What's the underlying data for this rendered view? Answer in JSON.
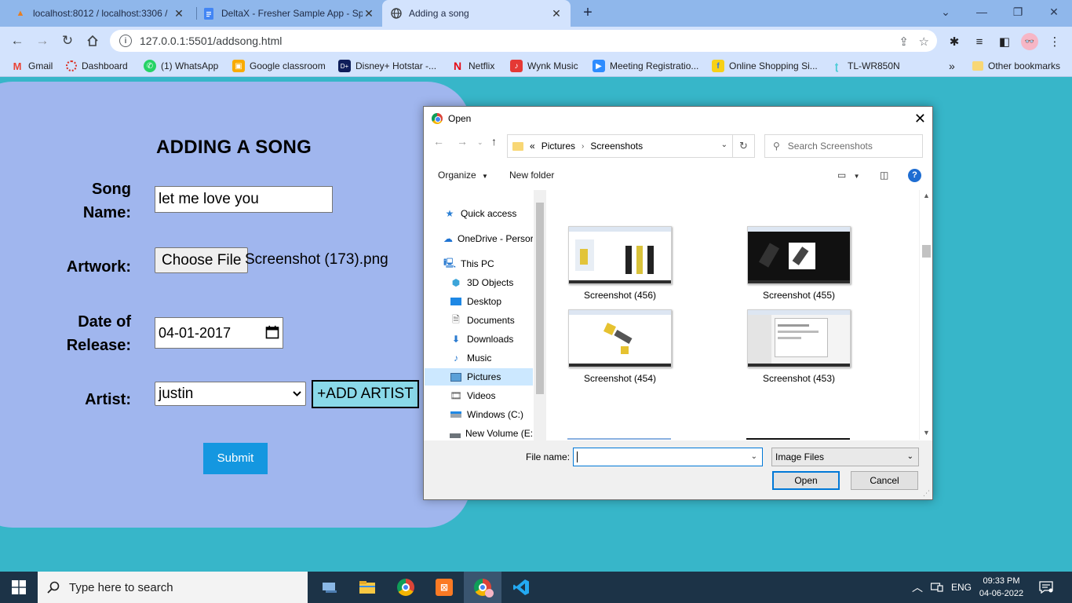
{
  "browser": {
    "tabs": [
      {
        "label": "localhost:8012 / localhost:3306 /",
        "active": false
      },
      {
        "label": "DeltaX - Fresher Sample App - Sp",
        "active": false
      },
      {
        "label": "Adding a song",
        "active": true
      }
    ],
    "url": "127.0.0.1:5501/addsong.html",
    "bookmarks": [
      "Gmail",
      "Dashboard",
      "(1) WhatsApp",
      "Google classroom",
      "Disney+ Hotstar -...",
      "Netflix",
      "Wynk Music",
      "Meeting Registratio...",
      "Online Shopping Si...",
      "TL-WR850N"
    ],
    "other_bookmarks": "Other bookmarks",
    "more": "»"
  },
  "form": {
    "title": "ADDING A SONG",
    "song_name_label_1": "Song",
    "song_name_label_2": "Name:",
    "song_name_value": "let me love you",
    "artwork_label": "Artwork:",
    "choose_file": "Choose File",
    "file_chosen": "Screenshot (173).png",
    "date_label_1": "Date of",
    "date_label_2": "Release:",
    "date_value": "04-01-2017",
    "artist_label": "Artist:",
    "artist_value": "justin",
    "add_artist": "+ADD ARTIST",
    "submit": "Submit"
  },
  "dialog": {
    "title": "Open",
    "path_prefix": "«",
    "path": [
      "Pictures",
      "Screenshots"
    ],
    "search_placeholder": "Search Screenshots",
    "organize": "Organize",
    "new_folder": "New folder",
    "nav_items": [
      {
        "label": "Quick access",
        "icon": "star-icon"
      },
      {
        "label": "OneDrive - Persor",
        "icon": "cloud-icon"
      },
      {
        "label": "This PC",
        "icon": "computer-icon"
      },
      {
        "label": "3D Objects",
        "icon": "cube-icon"
      },
      {
        "label": "Desktop",
        "icon": "desktop-icon"
      },
      {
        "label": "Documents",
        "icon": "document-icon"
      },
      {
        "label": "Downloads",
        "icon": "download-icon"
      },
      {
        "label": "Music",
        "icon": "music-icon"
      },
      {
        "label": "Pictures",
        "icon": "pictures-icon"
      },
      {
        "label": "Videos",
        "icon": "video-icon"
      },
      {
        "label": "Windows (C:)",
        "icon": "drive-icon"
      },
      {
        "label": "New Volume (E:)",
        "icon": "drive-icon"
      }
    ],
    "files": [
      "Screenshot (456)",
      "Screenshot (455)",
      "Screenshot (454)",
      "Screenshot (453)"
    ],
    "file_name_label": "File name:",
    "file_name_value": "",
    "file_type": "Image Files",
    "open": "Open",
    "cancel": "Cancel"
  },
  "taskbar": {
    "search_placeholder": "Type here to search",
    "lang": "ENG",
    "time": "09:33 PM",
    "date": "04-06-2022"
  },
  "colors": {
    "page_bg": "#37b6c9",
    "card_bg": "#a0b6ee",
    "submit_bg": "#1497e0",
    "add_artist_bg": "#8ad9e9"
  }
}
